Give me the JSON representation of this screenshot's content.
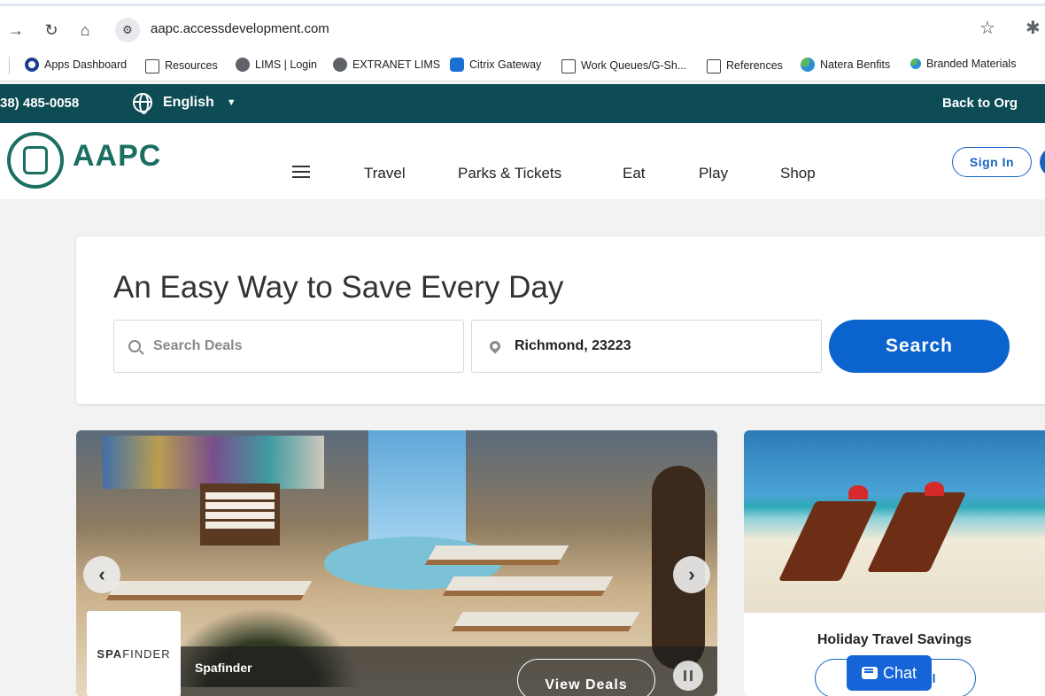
{
  "browser": {
    "url": "aapc.accessdevelopment.com",
    "bookmarks": [
      {
        "label": "Apps Dashboard",
        "icon": "ring-icon"
      },
      {
        "label": "Resources",
        "icon": "folder-icon"
      },
      {
        "label": "LIMS | Login",
        "icon": "globe-icon"
      },
      {
        "label": "EXTRANET LIMS",
        "icon": "globe-icon"
      },
      {
        "label": "Citrix Gateway",
        "icon": "lock-icon"
      },
      {
        "label": "Work Queues/G-Sh...",
        "icon": "folder-icon"
      },
      {
        "label": "References",
        "icon": "folder-icon"
      },
      {
        "label": "Natera Benfits",
        "icon": "clover-icon"
      },
      {
        "label": "Branded Materials",
        "icon": "clover-icon"
      }
    ]
  },
  "utility": {
    "phone": "38) 485-0058",
    "language": "English",
    "back": "Back to Org"
  },
  "header": {
    "logo_text": "AAPC",
    "nav": [
      "Travel",
      "Parks & Tickets",
      "Eat",
      "Play",
      "Shop"
    ],
    "signin": "Sign In"
  },
  "hero": {
    "headline": "An Easy Way to Save Every Day",
    "search_placeholder": "Search Deals",
    "location": "Richmond, 23223",
    "search_button": "Search"
  },
  "carousel": {
    "brand_logo_bold": "SPA",
    "brand_logo_light": "FINDER",
    "title": "Spafinder",
    "cta": "View Deals",
    "prev": "‹",
    "next": "›"
  },
  "holiday": {
    "title": "Holiday Travel Savings",
    "button": "Search Travel"
  },
  "chat": {
    "label": "Chat"
  },
  "colors": {
    "brand_teal": "#0d4c55",
    "logo_green": "#1b6f62",
    "primary_blue": "#0b63ce"
  }
}
